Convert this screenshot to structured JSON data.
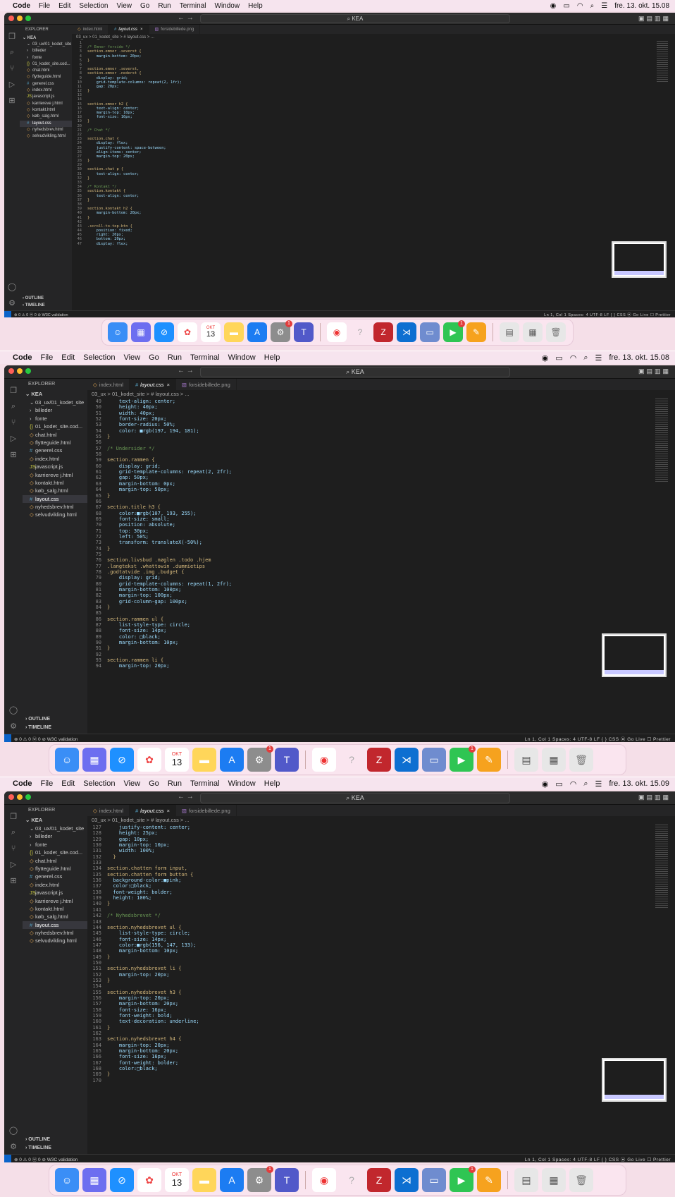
{
  "menubar": {
    "app": "Code",
    "items": [
      "File",
      "Edit",
      "Selection",
      "View",
      "Go",
      "Run",
      "Terminal",
      "Window",
      "Help"
    ],
    "time1": "fre. 13. okt. 15.08",
    "time2": "fre. 13. okt. 15.08",
    "time3": "fre. 13. okt. 15.09"
  },
  "window": {
    "search": "KEA"
  },
  "explorer": {
    "title": "EXPLORER",
    "root": "KEA",
    "folder": "03_ux/01_kodet_site",
    "items": [
      {
        "label": "billeder",
        "type": "folder"
      },
      {
        "label": "fonte",
        "type": "folder"
      },
      {
        "label": "01_kodet_site.cod...",
        "type": "json"
      },
      {
        "label": "chat.html",
        "type": "html"
      },
      {
        "label": "flytteguide.html",
        "type": "html"
      },
      {
        "label": "generel.css",
        "type": "css"
      },
      {
        "label": "index.html",
        "type": "html"
      },
      {
        "label": "javascript.js",
        "type": "js"
      },
      {
        "label": "karriereve j.html",
        "type": "html"
      },
      {
        "label": "kontakt.html",
        "type": "html"
      },
      {
        "label": "køb_salg.html",
        "type": "html"
      },
      {
        "label": "layout.css",
        "type": "css",
        "active": true
      },
      {
        "label": "nyhedsbrev.html",
        "type": "html"
      },
      {
        "label": "selvudvikling.html",
        "type": "html"
      }
    ],
    "outline": "OUTLINE",
    "timeline": "TIMELINE"
  },
  "tabs": [
    {
      "label": "index.html",
      "type": "html"
    },
    {
      "label": "layout.css",
      "type": "css",
      "active": true
    },
    {
      "label": "forsidebillede.png",
      "type": "png"
    }
  ],
  "breadcrumb": "03_ux > 01_kodet_site > # layout.css > ...",
  "status": {
    "left": "⊗ 0 ⚠ 0   ⓦ 0   ⊘ W3C validation",
    "right": "Ln 1, Col 1   Spaces: 4   UTF-8   LF   { } CSS   ⦿ Go Live   ☐ Prettier"
  },
  "code1": [
    [
      "1",
      ""
    ],
    [
      "2",
      "/* Emner forside */"
    ],
    [
      "3",
      "section.emner .severst {"
    ],
    [
      "4",
      "    margin-bottom: 20px;"
    ],
    [
      "5",
      "}"
    ],
    [
      "6",
      ""
    ],
    [
      "7",
      "section.emner .severst,"
    ],
    [
      "8",
      "section.emner .nederst {"
    ],
    [
      "9",
      "    display: grid;"
    ],
    [
      "10",
      "    grid-template-columns: repeat(2, 1fr);"
    ],
    [
      "11",
      "    gap: 20px;"
    ],
    [
      "12",
      "}"
    ],
    [
      "13",
      ""
    ],
    [
      "14",
      ""
    ],
    [
      "15",
      "section.emner h2 {"
    ],
    [
      "16",
      "    text-align: center;"
    ],
    [
      "17",
      "    margin-top: 10px;"
    ],
    [
      "18",
      "    font-size: 16px;"
    ],
    [
      "19",
      "}"
    ],
    [
      "20",
      ""
    ],
    [
      "21",
      "/* Chat */"
    ],
    [
      "22",
      ""
    ],
    [
      "23",
      "section.chat {"
    ],
    [
      "24",
      "    display: flex;"
    ],
    [
      "25",
      "    justify-content: space-between;"
    ],
    [
      "26",
      "    align-items: center;"
    ],
    [
      "27",
      "    margin-top: 20px;"
    ],
    [
      "28",
      "}"
    ],
    [
      "29",
      ""
    ],
    [
      "30",
      "section.chat p {"
    ],
    [
      "31",
      "    text-align: center;"
    ],
    [
      "32",
      "}"
    ],
    [
      "33",
      ""
    ],
    [
      "34",
      "/* Kontakt */"
    ],
    [
      "35",
      "section.kontakt {"
    ],
    [
      "36",
      "    text-align: center;"
    ],
    [
      "37",
      "}"
    ],
    [
      "38",
      ""
    ],
    [
      "39",
      "section.kontakt h2 {"
    ],
    [
      "40",
      "    margin-bottom: 20px;"
    ],
    [
      "41",
      "}"
    ],
    [
      "42",
      ""
    ],
    [
      "43",
      ".scroll-to-top-btn {"
    ],
    [
      "44",
      "    position: fixed;"
    ],
    [
      "45",
      "    right: 20px;"
    ],
    [
      "46",
      "    bottom: 20px;"
    ],
    [
      "47",
      "    display: flex;"
    ]
  ],
  "code2": [
    [
      "49",
      "    text-align: center;"
    ],
    [
      "50",
      "    height: 40px;"
    ],
    [
      "51",
      "    width: 40px;"
    ],
    [
      "52",
      "    font-size: 20px;"
    ],
    [
      "53",
      "    border-radius: 50%;"
    ],
    [
      "54",
      "    color: ■rgb(197, 194, 181);"
    ],
    [
      "55",
      "}"
    ],
    [
      "56",
      ""
    ],
    [
      "57",
      "/* Undersider */"
    ],
    [
      "58",
      ""
    ],
    [
      "59",
      "section.rammen {"
    ],
    [
      "60",
      "    display: grid;"
    ],
    [
      "61",
      "    grid-template-columns: repeat(2, 2fr);"
    ],
    [
      "62",
      "    gap: 50px;"
    ],
    [
      "63",
      "    margin-bottom: 0px;"
    ],
    [
      "64",
      "    margin-top: 50px;"
    ],
    [
      "65",
      "}"
    ],
    [
      "66",
      ""
    ],
    [
      "67",
      "section.title h3 {"
    ],
    [
      "68",
      "    color:■rgb(107, 193, 255);"
    ],
    [
      "69",
      "    font-size: small;"
    ],
    [
      "70",
      "    position: absolute;"
    ],
    [
      "71",
      "    top: 30px;"
    ],
    [
      "72",
      "    left: 50%;"
    ],
    [
      "73",
      "    transform: translateX(-50%);"
    ],
    [
      "74",
      "}"
    ],
    [
      "75",
      ""
    ],
    [
      "76",
      "section.livsbud .nøglen .todo .hjem"
    ],
    [
      "77",
      ".langtekst .whattowin .dummietips"
    ],
    [
      "78",
      ".godtatvide .img .budget {"
    ],
    [
      "79",
      "    display: grid;"
    ],
    [
      "80",
      "    grid-template-columns: repeat(1, 2fr);"
    ],
    [
      "81",
      "    margin-bottom: 100px;"
    ],
    [
      "82",
      "    margin-top: 100px;"
    ],
    [
      "83",
      "    grid-column-gap: 100px;"
    ],
    [
      "84",
      "}"
    ],
    [
      "85",
      ""
    ],
    [
      "86",
      "section.rammen ul {"
    ],
    [
      "87",
      "    list-style-type: circle;"
    ],
    [
      "88",
      "    font-size: 14px;"
    ],
    [
      "89",
      "    color: □black;"
    ],
    [
      "90",
      "    margin-bottom: 10px;"
    ],
    [
      "91",
      "}"
    ],
    [
      "92",
      ""
    ],
    [
      "93",
      "section.rammen li {"
    ],
    [
      "94",
      "    margin-top: 20px;"
    ]
  ],
  "code3": [
    [
      "127",
      "    justify-content: center;"
    ],
    [
      "128",
      "    height: 25px;"
    ],
    [
      "129",
      "    gap: 10px;"
    ],
    [
      "130",
      "    margin-top: 10px;"
    ],
    [
      "131",
      "    width: 100%;"
    ],
    [
      "132",
      "  }"
    ],
    [
      "133",
      ""
    ],
    [
      "134",
      "section.chatten form input,"
    ],
    [
      "135",
      "section.chatten form button {"
    ],
    [
      "136",
      "  background-color:■pink;"
    ],
    [
      "137",
      "  color:□black;"
    ],
    [
      "138",
      "  font-weight: bolder;"
    ],
    [
      "139",
      "  height: 100%;"
    ],
    [
      "140",
      "}"
    ],
    [
      "141",
      ""
    ],
    [
      "142",
      "/* Nyhedsbrevet */"
    ],
    [
      "143",
      ""
    ],
    [
      "144",
      "section.nyhedsbrevet ul {"
    ],
    [
      "145",
      "    list-style-type: circle;"
    ],
    [
      "146",
      "    font-size: 14px;"
    ],
    [
      "147",
      "    color:■rgb(156, 147, 133);"
    ],
    [
      "148",
      "    margin-bottom: 10px;"
    ],
    [
      "149",
      "}"
    ],
    [
      "150",
      ""
    ],
    [
      "151",
      "section.nyhedsbrevet li {"
    ],
    [
      "152",
      "    margin-top: 20px;"
    ],
    [
      "153",
      "}"
    ],
    [
      "154",
      ""
    ],
    [
      "155",
      "section.nyhedsbrevet h3 {"
    ],
    [
      "156",
      "    margin-top: 20px;"
    ],
    [
      "157",
      "    margin-bottom: 20px;"
    ],
    [
      "158",
      "    font-size: 16px;"
    ],
    [
      "159",
      "    font-weight: bold;"
    ],
    [
      "160",
      "    text-decoration: underline;"
    ],
    [
      "161",
      "}"
    ],
    [
      "162",
      ""
    ],
    [
      "163",
      "section.nyhedsbrevet h4 {"
    ],
    [
      "164",
      "    margin-top: 20px;"
    ],
    [
      "165",
      "    margin-bottom: 20px;"
    ],
    [
      "166",
      "    font-size: 16px;"
    ],
    [
      "167",
      "    font-weight: bolder;"
    ],
    [
      "168",
      "    color:□black;"
    ],
    [
      "169",
      "}"
    ],
    [
      "170",
      ""
    ]
  ],
  "dock": {
    "calendar_month": "OKT",
    "calendar_day": "13",
    "badge": "1"
  },
  "colors": {
    "menubar": "#f6e4ee",
    "editor_bg": "#1e1e1e",
    "sidebar_bg": "#252526",
    "accent": "#007acc"
  }
}
